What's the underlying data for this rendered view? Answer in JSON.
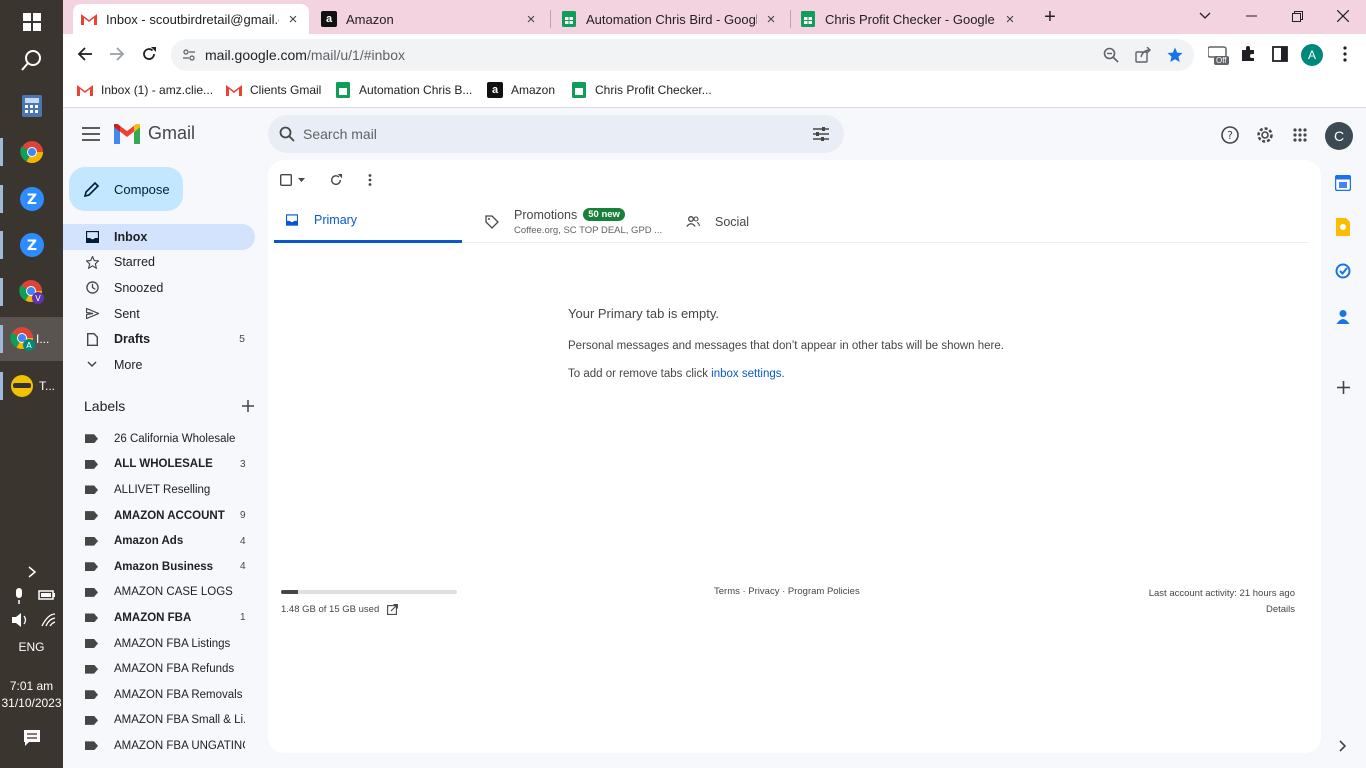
{
  "taskbar": {
    "items": [
      "windows-start",
      "search",
      "calculator",
      "chrome",
      "zoom",
      "zoom",
      "chrome-profile-v",
      "chrome-profile-a",
      "app-t"
    ],
    "active_label": "I...",
    "t_label": "T...",
    "lang": "ENG",
    "time": "7:01 am",
    "date": "31/10/2023"
  },
  "browser": {
    "tabs": [
      {
        "title": "Inbox - scoutbirdretail@gmail.com",
        "icon": "gmail-icon",
        "active": true
      },
      {
        "title": "Amazon",
        "icon": "amazon-icon",
        "active": false
      },
      {
        "title": "Automation Chris Bird - Google",
        "icon": "sheets-icon",
        "active": false
      },
      {
        "title": "Chris Profit Checker - Google Sh",
        "icon": "sheets-icon",
        "active": false
      }
    ],
    "url_host": "mail.google.com",
    "url_path": "/mail/u/1/#inbox",
    "profile_initial": "A",
    "ext_badge": "Off",
    "bookmarks": [
      {
        "label": "Inbox (1) - amz.clie...",
        "icon": "gmail-icon"
      },
      {
        "label": "Clients Gmail",
        "icon": "gmail-icon"
      },
      {
        "label": "Automation Chris B...",
        "icon": "sheets-icon"
      },
      {
        "label": "Amazon",
        "icon": "amazon-icon"
      },
      {
        "label": "Chris Profit Checker...",
        "icon": "sheets-icon"
      }
    ]
  },
  "gmail": {
    "brand": "Gmail",
    "search_placeholder": "Search mail",
    "account_initial": "C",
    "compose_label": "Compose",
    "nav": [
      {
        "label": "Inbox",
        "icon": "inbox-icon",
        "count": ""
      },
      {
        "label": "Starred",
        "icon": "star-icon",
        "count": ""
      },
      {
        "label": "Snoozed",
        "icon": "clock-icon",
        "count": ""
      },
      {
        "label": "Sent",
        "icon": "send-icon",
        "count": ""
      },
      {
        "label": "Drafts",
        "icon": "draft-icon",
        "count": "5"
      },
      {
        "label": "More",
        "icon": "chevron-down-icon",
        "count": ""
      }
    ],
    "labels_title": "Labels",
    "labels": [
      {
        "name": "26 California Wholesale",
        "count": "",
        "bold": false
      },
      {
        "name": "ALL WHOLESALE",
        "count": "3",
        "bold": true
      },
      {
        "name": "ALLIVET Reselling",
        "count": "",
        "bold": false
      },
      {
        "name": "AMAZON ACCOUNT",
        "count": "9",
        "bold": true
      },
      {
        "name": "Amazon Ads",
        "count": "4",
        "bold": true
      },
      {
        "name": "Amazon Business",
        "count": "4",
        "bold": true
      },
      {
        "name": "AMAZON CASE LOGS",
        "count": "",
        "bold": false
      },
      {
        "name": "AMAZON FBA",
        "count": "1",
        "bold": true
      },
      {
        "name": "AMAZON FBA Listings",
        "count": "",
        "bold": false
      },
      {
        "name": "AMAZON FBA Refunds",
        "count": "",
        "bold": false
      },
      {
        "name": "AMAZON FBA Removals",
        "count": "",
        "bold": false
      },
      {
        "name": "AMAZON FBA Small & Li...",
        "count": "",
        "bold": false
      },
      {
        "name": "AMAZON FBA UNGATING",
        "count": "",
        "bold": false
      }
    ],
    "category_tabs": {
      "primary": "Primary",
      "promotions": "Promotions",
      "promotions_badge": "50 new",
      "promotions_sub": "Coffee.org, SC TOP DEAL, GPD ...",
      "social": "Social"
    },
    "empty": {
      "title": "Your Primary tab is empty.",
      "line1": "Personal messages and messages that don’t appear in other tabs will be shown here.",
      "line2_prefix": "To add or remove tabs click ",
      "line2_link": "inbox settings",
      "line2_suffix": "."
    },
    "storage": {
      "text": "1.48 GB of 15 GB used",
      "fraction": 0.099
    },
    "footer": {
      "terms": "Terms · Privacy · Program Policies",
      "activity": "Last account activity: 21 hours ago",
      "details": "Details"
    }
  },
  "colors": {
    "accent": "#0b57d0",
    "compose_bg": "#c2e7ff",
    "tabstrip": "#f4d3e0",
    "badge": "#188038"
  }
}
